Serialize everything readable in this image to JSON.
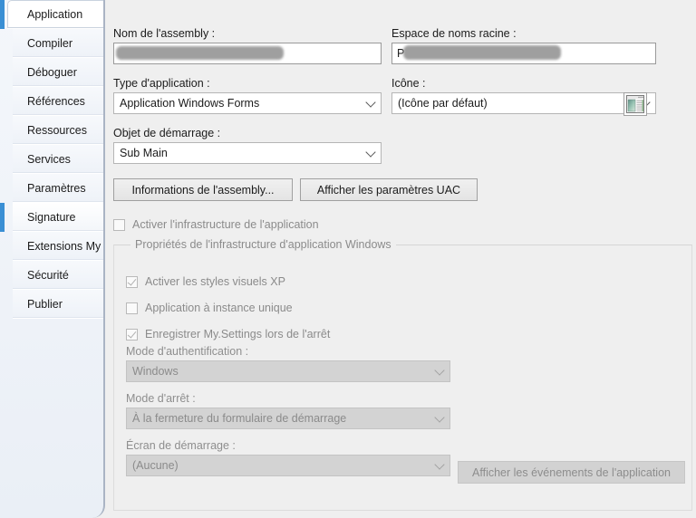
{
  "sidebar": {
    "tabs": [
      {
        "label": "Application",
        "state": "selected"
      },
      {
        "label": "Compiler",
        "state": "normal"
      },
      {
        "label": "Déboguer",
        "state": "normal"
      },
      {
        "label": "Références",
        "state": "normal"
      },
      {
        "label": "Ressources",
        "state": "normal"
      },
      {
        "label": "Services",
        "state": "normal"
      },
      {
        "label": "Paramètres",
        "state": "normal"
      },
      {
        "label": "Signature",
        "state": "hovered"
      },
      {
        "label": "Extensions My",
        "state": "normal"
      },
      {
        "label": "Sécurité",
        "state": "normal"
      },
      {
        "label": "Publier",
        "state": "normal"
      }
    ]
  },
  "main": {
    "assembly_name": {
      "label": "Nom de l'assembly :",
      "value": "",
      "redacted": true
    },
    "root_namespace": {
      "label": "Espace de noms racine :",
      "value": "P",
      "redacted": true
    },
    "application_type": {
      "label": "Type d'application :",
      "value": "Application Windows Forms",
      "disabled": false
    },
    "icon": {
      "label": "Icône :",
      "value": "(Icône par défaut)",
      "disabled": false,
      "preview_icon": "application-window-icon"
    },
    "startup_object": {
      "label": "Objet de démarrage :",
      "value": "Sub Main",
      "disabled": false
    },
    "assembly_info_button": "Informations de l'assembly...",
    "uac_settings_button": "Afficher les paramètres UAC",
    "enable_framework_checkbox": {
      "label": "Activer l'infrastructure de l'application",
      "checked": false,
      "disabled": true
    },
    "groupbox": {
      "title": "Propriétés de l'infrastructure d'application Windows",
      "checkboxes": [
        {
          "label": "Activer les styles visuels XP",
          "checked": true,
          "disabled": true
        },
        {
          "label": "Application à instance unique",
          "checked": false,
          "disabled": true
        },
        {
          "label": "Enregistrer My.Settings lors de l'arrêt",
          "checked": true,
          "disabled": true
        }
      ],
      "auth_mode": {
        "label": "Mode d'authentification :",
        "value": "Windows",
        "disabled": true
      },
      "shutdown_mode": {
        "label": "Mode d'arrêt :",
        "value": "À la fermeture du formulaire de démarrage",
        "disabled": true
      },
      "splash_screen": {
        "label": "Écran de démarrage :",
        "value": "(Aucune)",
        "disabled": true
      },
      "view_events_button": {
        "label": "Afficher les événements de l'application",
        "disabled": true
      }
    }
  },
  "colors": {
    "accent": "#3a8fd4",
    "background": "#efefef",
    "sidebar_bg": "#eef2f8",
    "disabled_text": "#8b8b8b",
    "disabled_field": "#d3d3d3"
  }
}
